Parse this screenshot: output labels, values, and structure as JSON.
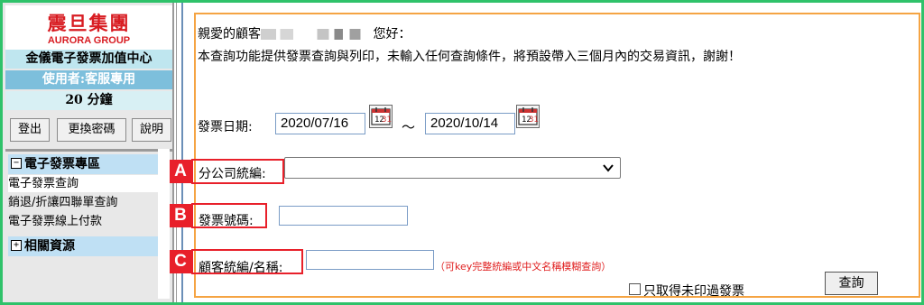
{
  "sidebar": {
    "logo_cn": "震旦集團",
    "logo_en": "AURORA GROUP",
    "center_name": "金儀電子發票加值中心",
    "user_label": "使用者:客服專用",
    "timer": "20 分鐘",
    "buttons": {
      "logout": "登出",
      "change_password": "更換密碼",
      "help": "說明"
    },
    "menu": {
      "einvoice_section": "電子發票專區",
      "einvoice_box": "−",
      "items": [
        "電子發票查詢",
        "銷退/折讓四聯單查詢",
        "電子發票線上付款"
      ],
      "resources_section": "相關資源",
      "resources_box": "+"
    }
  },
  "main": {
    "greeting_prefix": "親愛的顧客",
    "greeting_suffix": "您好：",
    "notice": "本查詢功能提供發票查詢與列印，未輸入任何查詢條件，將預設帶入三個月內的交易資訊，謝謝！",
    "invoice_date_label": "發票日期:",
    "date_from": "2020/07/16",
    "date_to": "2020/10/14",
    "tilde": "～",
    "branch_tax_label": "分公司統編:",
    "branch_tax_value": "",
    "invoice_no_label": "發票號碼:",
    "invoice_no_value": "",
    "customer_label": "顧客統編/名稱:",
    "customer_value": "",
    "customer_hint": "（可key完整統編或中文名稱模糊查詢）",
    "unprinted_only_label": "只取得未印過發票",
    "query_button": "查詢"
  },
  "annotations": {
    "a": "A",
    "b": "B",
    "c": "C"
  },
  "colors": {
    "frame_green": "#2fc26a",
    "logo_red": "#d81c22",
    "form_orange": "#f5a443",
    "annotation_red": "#e8202a",
    "hint_red": "#e02020"
  }
}
